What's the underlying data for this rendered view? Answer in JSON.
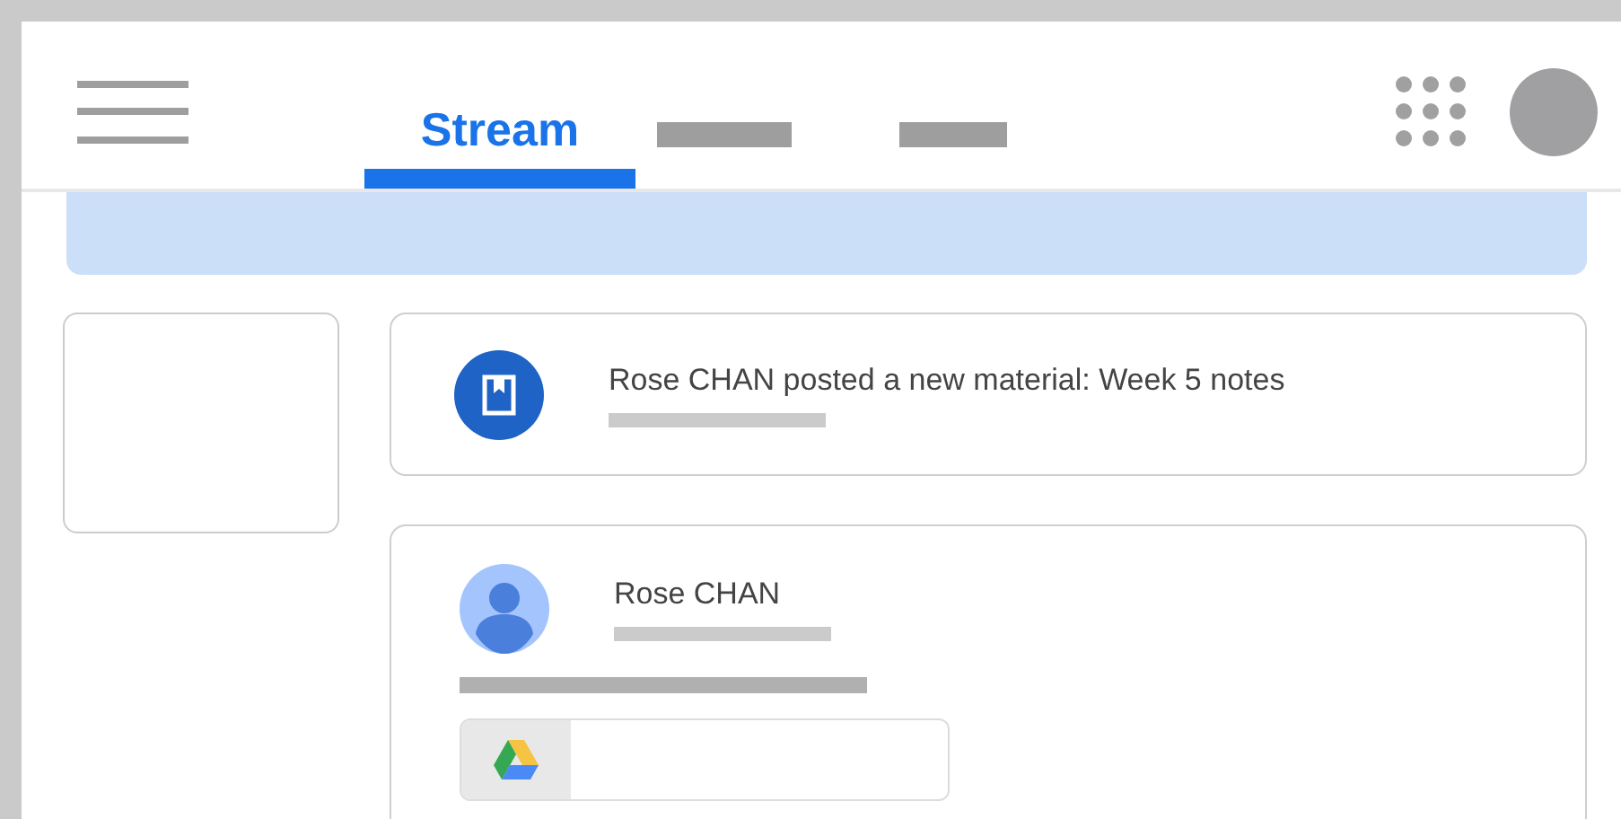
{
  "tabs": [
    {
      "kind": "text",
      "label": "Stream",
      "selected": true
    },
    {
      "kind": "placeholder",
      "selected": false
    },
    {
      "kind": "placeholder",
      "selected": false
    }
  ],
  "stream": [
    {
      "kind": "material",
      "text": "Rose CHAN posted a new material: Week 5 notes"
    },
    {
      "kind": "post",
      "author": "Rose CHAN",
      "attachment": {
        "kind": "drive"
      }
    }
  ]
}
